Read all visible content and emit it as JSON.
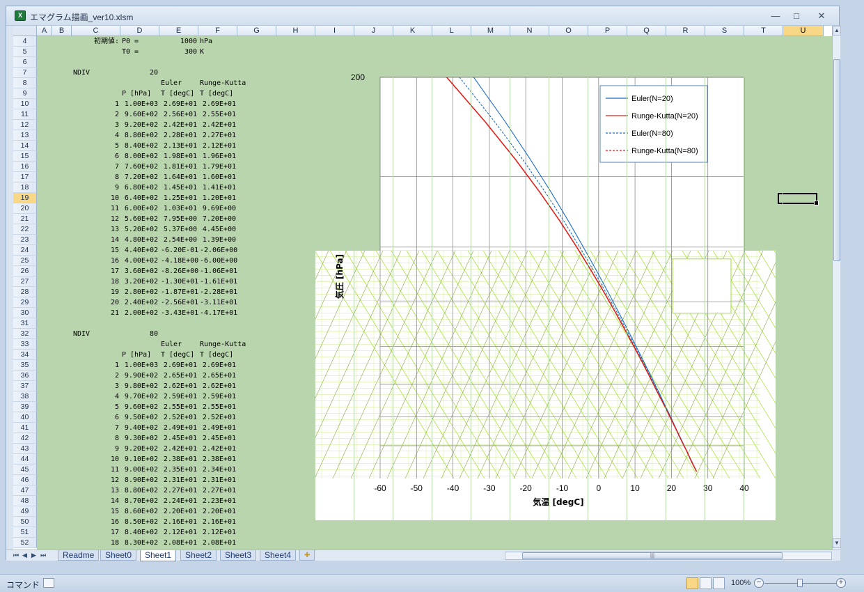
{
  "window": {
    "title": "エマグラム描画_ver10.xlsm",
    "minimize": "—",
    "maximize": "□",
    "close": "✕"
  },
  "columns": [
    "A",
    "B",
    "C",
    "D",
    "E",
    "F",
    "G",
    "H",
    "I",
    "J",
    "K",
    "L",
    "M",
    "N",
    "O",
    "P",
    "Q",
    "R",
    "S",
    "T",
    "U"
  ],
  "active_column": "U",
  "row_numbers": [
    "4",
    "5",
    "6",
    "7",
    "8",
    "9",
    "10",
    "11",
    "12",
    "13",
    "14",
    "15",
    "16",
    "17",
    "18",
    "19",
    "20",
    "21",
    "22",
    "23",
    "24",
    "25",
    "26",
    "27",
    "28",
    "29",
    "30",
    "31",
    "32",
    "33",
    "34",
    "35",
    "36",
    "37",
    "38",
    "39",
    "40",
    "41",
    "42",
    "43",
    "44",
    "45",
    "46",
    "47",
    "48",
    "49",
    "50",
    "51",
    "52"
  ],
  "active_row": "19",
  "cells": {
    "init_label": "初期値:",
    "p0_label": "P0 =",
    "p0_value": "1000",
    "p0_unit": "hPa",
    "t0_label": "T0 =",
    "t0_value": "300",
    "t0_unit": "K",
    "ndiv_label": "NDIV"
  },
  "tables": [
    {
      "ndiv": "20",
      "euler_label": "Euler",
      "rk_label": "Runge-Kutta",
      "col_p": "P [hPa]",
      "col_te": "T [degC]",
      "col_tr": "T [degC]",
      "rows": [
        [
          "1",
          "1.00E+03",
          "2.69E+01",
          "2.69E+01"
        ],
        [
          "2",
          "9.60E+02",
          "2.56E+01",
          "2.55E+01"
        ],
        [
          "3",
          "9.20E+02",
          "2.42E+01",
          "2.42E+01"
        ],
        [
          "4",
          "8.80E+02",
          "2.28E+01",
          "2.27E+01"
        ],
        [
          "5",
          "8.40E+02",
          "2.13E+01",
          "2.12E+01"
        ],
        [
          "6",
          "8.00E+02",
          "1.98E+01",
          "1.96E+01"
        ],
        [
          "7",
          "7.60E+02",
          "1.81E+01",
          "1.79E+01"
        ],
        [
          "8",
          "7.20E+02",
          "1.64E+01",
          "1.60E+01"
        ],
        [
          "9",
          "6.80E+02",
          "1.45E+01",
          "1.41E+01"
        ],
        [
          "10",
          "6.40E+02",
          "1.25E+01",
          "1.20E+01"
        ],
        [
          "11",
          "6.00E+02",
          "1.03E+01",
          "9.69E+00"
        ],
        [
          "12",
          "5.60E+02",
          "7.95E+00",
          "7.20E+00"
        ],
        [
          "13",
          "5.20E+02",
          "5.37E+00",
          "4.45E+00"
        ],
        [
          "14",
          "4.80E+02",
          "2.54E+00",
          "1.39E+00"
        ],
        [
          "15",
          "4.40E+02",
          "-6.20E-01",
          "-2.06E+00"
        ],
        [
          "16",
          "4.00E+02",
          "-4.18E+00",
          "-6.00E+00"
        ],
        [
          "17",
          "3.60E+02",
          "-8.26E+00",
          "-1.06E+01"
        ],
        [
          "18",
          "3.20E+02",
          "-1.30E+01",
          "-1.61E+01"
        ],
        [
          "19",
          "2.80E+02",
          "-1.87E+01",
          "-2.28E+01"
        ],
        [
          "20",
          "2.40E+02",
          "-2.56E+01",
          "-3.11E+01"
        ],
        [
          "21",
          "2.00E+02",
          "-3.43E+01",
          "-4.17E+01"
        ]
      ]
    },
    {
      "ndiv": "80",
      "euler_label": "Euler",
      "rk_label": "Runge-Kutta",
      "col_p": "P [hPa]",
      "col_te": "T [degC]",
      "col_tr": "T [degC]",
      "rows": [
        [
          "1",
          "1.00E+03",
          "2.69E+01",
          "2.69E+01"
        ],
        [
          "2",
          "9.90E+02",
          "2.65E+01",
          "2.65E+01"
        ],
        [
          "3",
          "9.80E+02",
          "2.62E+01",
          "2.62E+01"
        ],
        [
          "4",
          "9.70E+02",
          "2.59E+01",
          "2.59E+01"
        ],
        [
          "5",
          "9.60E+02",
          "2.55E+01",
          "2.55E+01"
        ],
        [
          "6",
          "9.50E+02",
          "2.52E+01",
          "2.52E+01"
        ],
        [
          "7",
          "9.40E+02",
          "2.49E+01",
          "2.49E+01"
        ],
        [
          "8",
          "9.30E+02",
          "2.45E+01",
          "2.45E+01"
        ],
        [
          "9",
          "9.20E+02",
          "2.42E+01",
          "2.42E+01"
        ],
        [
          "10",
          "9.10E+02",
          "2.38E+01",
          "2.38E+01"
        ],
        [
          "11",
          "9.00E+02",
          "2.35E+01",
          "2.34E+01"
        ],
        [
          "12",
          "8.90E+02",
          "2.31E+01",
          "2.31E+01"
        ],
        [
          "13",
          "8.80E+02",
          "2.27E+01",
          "2.27E+01"
        ],
        [
          "14",
          "8.70E+02",
          "2.24E+01",
          "2.23E+01"
        ],
        [
          "15",
          "8.60E+02",
          "2.20E+01",
          "2.20E+01"
        ],
        [
          "16",
          "8.50E+02",
          "2.16E+01",
          "2.16E+01"
        ],
        [
          "17",
          "8.40E+02",
          "2.12E+01",
          "2.12E+01"
        ],
        [
          "18",
          "8.30E+02",
          "2.08E+01",
          "2.08E+01"
        ]
      ]
    }
  ],
  "chart_data": {
    "type": "line",
    "title": "",
    "xlabel": "気温 [degC]",
    "ylabel": "気圧 [hPa]",
    "xlim": [
      -60,
      40
    ],
    "ylim": [
      1000,
      200
    ],
    "y_tick_labels": [
      "200"
    ],
    "x_ticks": [
      "-60",
      "-50",
      "-40",
      "-30",
      "-20",
      "-10",
      "0",
      "10",
      "20",
      "30",
      "40"
    ],
    "legend_position": "top-right",
    "series": [
      {
        "name": "Euler(N=20)",
        "color": "#1f6fc4",
        "dash": "solid",
        "x": [
          26.9,
          25.6,
          24.2,
          22.8,
          21.3,
          19.8,
          18.1,
          16.4,
          14.5,
          12.5,
          10.3,
          7.95,
          5.37,
          2.54,
          -0.62,
          -4.18,
          -8.26,
          -13.0,
          -18.7,
          -25.6,
          -34.3
        ],
        "y": [
          1000,
          960,
          920,
          880,
          840,
          800,
          760,
          720,
          680,
          640,
          600,
          560,
          520,
          480,
          440,
          400,
          360,
          320,
          280,
          240,
          200
        ]
      },
      {
        "name": "Runge-Kutta(N=20)",
        "color": "#e0201a",
        "dash": "solid",
        "x": [
          26.9,
          25.5,
          24.2,
          22.7,
          21.2,
          19.6,
          17.9,
          16.0,
          14.1,
          12.0,
          9.69,
          7.2,
          4.45,
          1.39,
          -2.06,
          -6.0,
          -10.6,
          -16.1,
          -22.8,
          -31.1,
          -41.7
        ],
        "y": [
          1000,
          960,
          920,
          880,
          840,
          800,
          760,
          720,
          680,
          640,
          600,
          560,
          520,
          480,
          440,
          400,
          360,
          320,
          280,
          240,
          200
        ]
      },
      {
        "name": "Euler(N=80)",
        "color": "#1f6fc4",
        "dash": "dashed",
        "x": [
          26.9,
          25.5,
          24.2,
          22.8,
          21.2,
          19.7,
          18.0,
          16.2,
          14.3,
          12.3,
          10.0,
          7.6,
          4.9,
          1.9,
          -1.4,
          -5.2,
          -9.5,
          -14.6,
          -20.8,
          -28.5,
          -38.2
        ],
        "y": [
          1000,
          960,
          920,
          880,
          840,
          800,
          760,
          720,
          680,
          640,
          600,
          560,
          520,
          480,
          440,
          400,
          360,
          320,
          280,
          240,
          200
        ]
      },
      {
        "name": "Runge-Kutta(N=80)",
        "color": "#e0201a",
        "dash": "dashed",
        "x": [
          26.9,
          25.5,
          24.2,
          22.7,
          21.2,
          19.6,
          17.9,
          16.0,
          14.1,
          12.0,
          9.69,
          7.2,
          4.45,
          1.39,
          -2.06,
          -6.0,
          -10.6,
          -16.1,
          -22.8,
          -31.1,
          -41.7
        ],
        "y": [
          1000,
          960,
          920,
          880,
          840,
          800,
          760,
          720,
          680,
          640,
          600,
          560,
          520,
          480,
          440,
          400,
          360,
          320,
          280,
          240,
          200
        ]
      }
    ]
  },
  "sheet_tabs": [
    "Readme",
    "Sheet0",
    "Sheet1",
    "Sheet2",
    "Sheet3",
    "Sheet4"
  ],
  "active_tab": "Sheet1",
  "tab_nav": [
    "⏮",
    "◀",
    "▶",
    "⏭"
  ],
  "status": {
    "mode": "コマンド",
    "zoom": "100%"
  },
  "colors": {
    "grid_fill": "#ebf5e6",
    "emagram_light": "#9fe02a",
    "emagram_dark": "#6f8f1d"
  }
}
